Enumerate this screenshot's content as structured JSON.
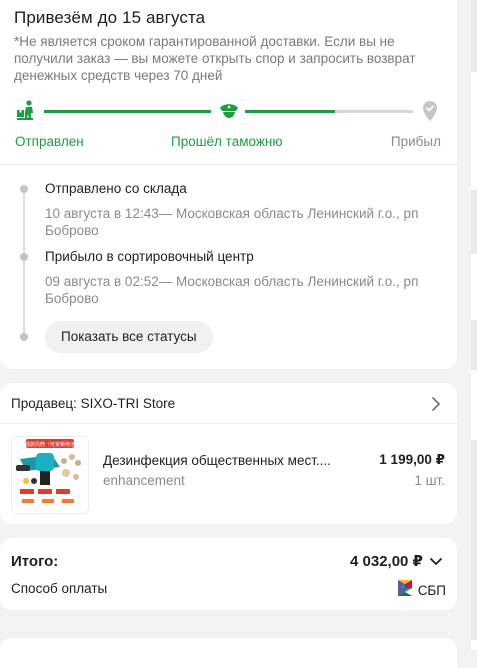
{
  "delivery": {
    "title": "Привезём до 15 августа",
    "disclaimer": "*Не является сроком гарантированной доставки. Если вы не получили заказ — вы можете открыть спор и запросить возврат денежных средств через 70 дней",
    "progress": 0.78,
    "stages": [
      {
        "label": "Отправлен",
        "icon": "courier-icon",
        "status": "done"
      },
      {
        "label": "Прошёл таможню",
        "icon": "customs-officer-icon",
        "status": "done"
      },
      {
        "label": "Прибыл",
        "icon": "location-pin-icon",
        "status": "pending"
      }
    ],
    "events": [
      {
        "title": "Отправлено со склада",
        "details": "10 августа в 12:43— Московская область Ленинский г.о., рп Боброво"
      },
      {
        "title": "Прибыло в сортировочный центр",
        "details": "09 августа в 02:52— Московская область Ленинский г.о., рп Боброво"
      }
    ],
    "show_all_label": "Показать все статусы"
  },
  "seller": {
    "title": "Продавец: SIXO-TRI Store",
    "product": {
      "name": "Дезинфекция общественных мест....",
      "variant": "enhancement",
      "price": "1 199,00 ₽",
      "qty": "1 шт.",
      "image_caption": "加强款风筒（可变频电池）"
    }
  },
  "total": {
    "label": "Итого:",
    "value": "4 032,00 ₽",
    "payment_label": "Способ оплаты",
    "payment_method": "СБП"
  },
  "colors": {
    "accent_green": "#1a9e3f",
    "muted_grey": "#8a8a8a",
    "background": "#f2f3f5"
  }
}
